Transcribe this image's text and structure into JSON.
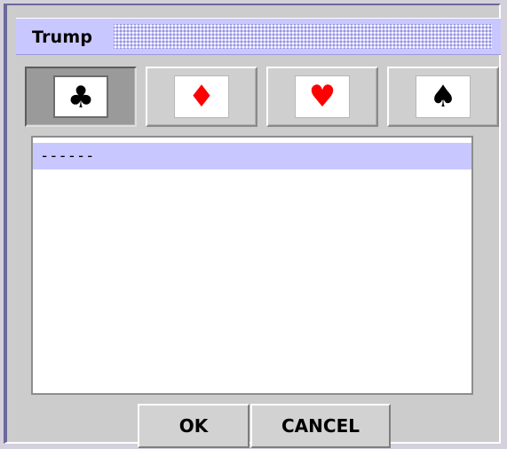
{
  "dialog": {
    "title": "Trump"
  },
  "suits": [
    {
      "name": "clubs",
      "glyph": "♣",
      "color": "#000000",
      "selected": true
    },
    {
      "name": "diamonds",
      "glyph": "♦",
      "color": "#ff0000",
      "selected": false
    },
    {
      "name": "hearts",
      "glyph": "♥",
      "color": "#ff0000",
      "selected": false
    },
    {
      "name": "spades",
      "glyph": "♠",
      "color": "#000000",
      "selected": false
    }
  ],
  "list": {
    "items": [
      "------"
    ]
  },
  "buttons": {
    "ok_label": "OK",
    "cancel_label": "CANCEL"
  },
  "colors": {
    "title_bg": "#c9c7ff",
    "selection_bg": "#c9c7ff"
  }
}
